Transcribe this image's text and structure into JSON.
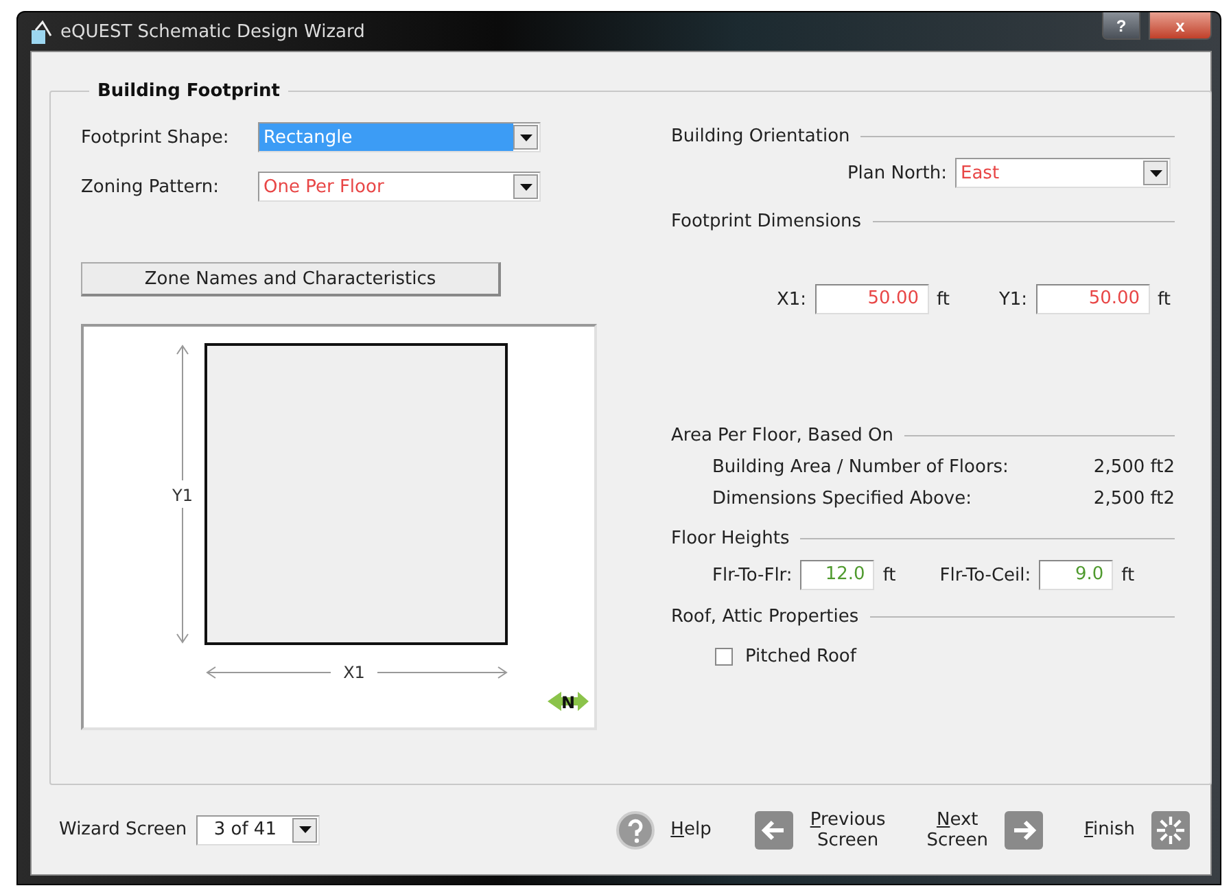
{
  "window": {
    "title": "eQUEST Schematic Design Wizard",
    "buttons": [
      {
        "kind": "help",
        "label": "?"
      },
      {
        "kind": "close",
        "label": "x"
      }
    ]
  },
  "group": {
    "title": "Building Footprint"
  },
  "footprint_shape": {
    "label": "Footprint Shape:",
    "value": "Rectangle",
    "selected": true
  },
  "zoning_pattern": {
    "label": "Zoning Pattern:",
    "value": "One Per Floor",
    "selected": false,
    "color": "#e84646"
  },
  "zone_button": {
    "label": "Zone Names and Characteristics"
  },
  "diagram": {
    "y_label": "Y1",
    "x_label": "X1",
    "north_label": "N"
  },
  "orientation": {
    "heading": "Building Orientation",
    "label": "Plan North:",
    "value": "East",
    "color": "#e84646"
  },
  "dimensions": {
    "heading": "Footprint Dimensions",
    "fields": [
      {
        "label": "X1:",
        "value": "50.00",
        "unit": "ft",
        "color": "#e84646"
      },
      {
        "label": "Y1:",
        "value": "50.00",
        "unit": "ft",
        "color": "#e84646"
      }
    ]
  },
  "area": {
    "heading": "Area Per Floor, Based On",
    "rows": [
      {
        "label": "Building Area / Number of Floors:",
        "value": "2,500 ft2"
      },
      {
        "label": "Dimensions Specified Above:",
        "value": "2,500 ft2"
      }
    ]
  },
  "floor_heights": {
    "heading": "Floor Heights",
    "fields": [
      {
        "label": "Flr-To-Flr:",
        "value": "12.0",
        "unit": "ft",
        "color": "#4f9a2e"
      },
      {
        "label": "Flr-To-Ceil:",
        "value": "9.0",
        "unit": "ft",
        "color": "#4f9a2e"
      }
    ]
  },
  "roof": {
    "heading": "Roof, Attic Properties",
    "checkbox": {
      "label": "Pitched Roof",
      "checked": false
    }
  },
  "footer": {
    "label": "Wizard Screen",
    "screen": "3 of 41",
    "actions": [
      {
        "kind": "help",
        "label": "Help"
      },
      {
        "kind": "back",
        "label": "Previous Screen"
      },
      {
        "kind": "next",
        "label": "Next Screen"
      },
      {
        "kind": "finish",
        "label": "Finish"
      }
    ]
  }
}
